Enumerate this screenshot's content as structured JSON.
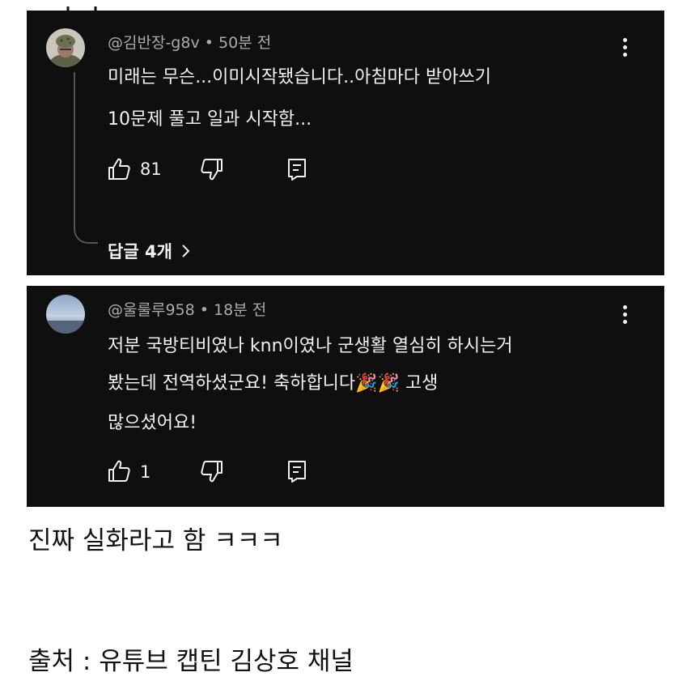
{
  "comments": [
    {
      "handle": "@김반장-g8v",
      "time": "50분 전",
      "lines": [
        "미래는 무슨...이미시작됐습니다..아침마다 받아쓰기",
        "10문제 풀고 일과 시작함..."
      ],
      "likes": "81",
      "replies_label": "답글 4개"
    },
    {
      "handle": "@울룰루958",
      "time": "18분 전",
      "lines": [
        "저분 국방티비였나 knn이였나 군생활 열심히 하시는거",
        "봤는데 전역하셨군요! 축하합니다🎉🎉 고생",
        "많으셨어요!"
      ],
      "likes": "1"
    }
  ],
  "separator": "•",
  "caption": "진짜 실화라고 함 ㅋㅋㅋ",
  "source": "출처 : 유튜브 캡틴 김상호 채널",
  "colors": {
    "card_bg": "#0f0f0f",
    "text": "#f1f1f1",
    "meta": "#aaaaaa"
  },
  "icons": [
    "thumbs-up-icon",
    "thumbs-down-icon",
    "reply-icon",
    "more-vert-icon",
    "chevron-right-icon"
  ]
}
